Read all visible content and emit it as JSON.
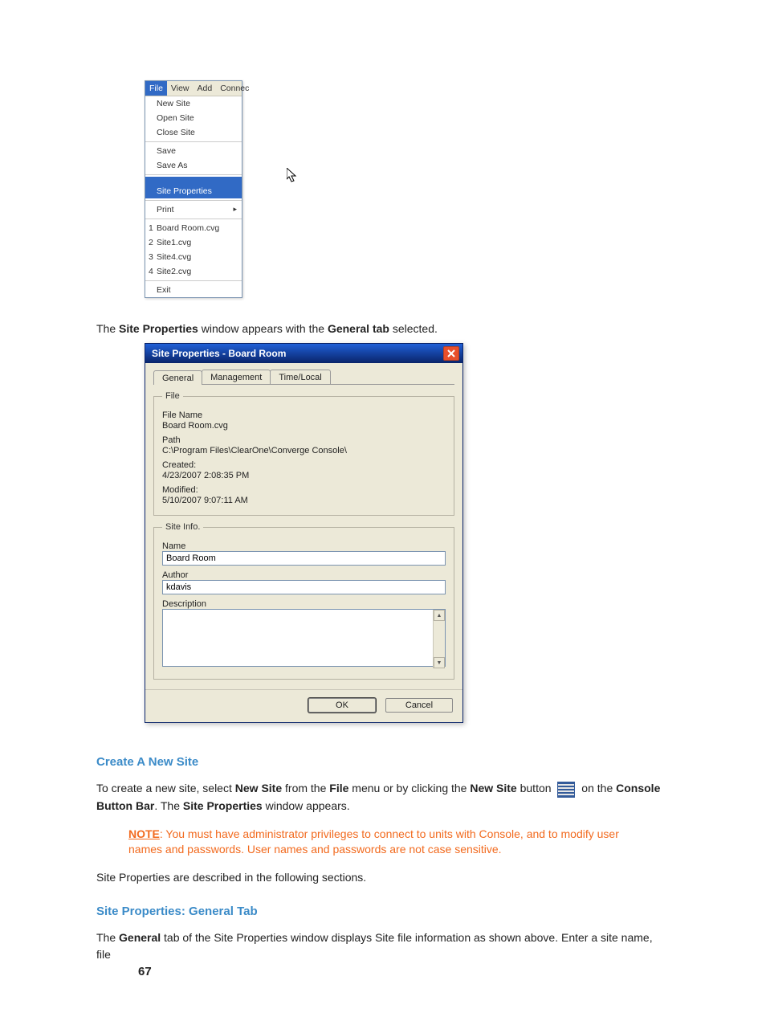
{
  "filemenu": {
    "menubar": [
      "File",
      "View",
      "Add",
      "Connec"
    ],
    "groups": [
      [
        "New Site",
        "Open Site",
        "Close Site"
      ],
      [
        "Save",
        "Save As"
      ],
      [
        "Site Properties"
      ],
      [
        "Print"
      ]
    ],
    "recent": [
      {
        "n": "1",
        "label": "Board Room.cvg"
      },
      {
        "n": "2",
        "label": "Site1.cvg"
      },
      {
        "n": "3",
        "label": "Site4.cvg"
      },
      {
        "n": "4",
        "label": "Site2.cvg"
      }
    ],
    "exit": "Exit"
  },
  "para1": {
    "a": "The ",
    "b": "Site Properties",
    "c": " window appears with the ",
    "d": "General tab",
    "e": " selected."
  },
  "dialog": {
    "title": "Site Properties - Board Room",
    "tabs": [
      "General",
      "Management",
      "Time/Local"
    ],
    "file_legend": "File",
    "filename_label": "File Name",
    "filename_value": "Board Room.cvg",
    "path_label": "Path",
    "path_value": "C:\\Program Files\\ClearOne\\Converge Console\\",
    "created_label": "Created:",
    "created_value": "4/23/2007 2:08:35 PM",
    "modified_label": "Modified:",
    "modified_value": "5/10/2007 9:07:11 AM",
    "siteinfo_legend": "Site Info.",
    "name_label": "Name",
    "name_value": "Board Room",
    "author_label": "Author",
    "author_value": "kdavis",
    "description_label": "Description",
    "ok": "OK",
    "cancel": "Cancel"
  },
  "sec1": "Create A New Site",
  "para2": {
    "a": "To create a new site, select ",
    "b": "New Site",
    "c": " from the ",
    "d": "File",
    "e": " menu or by clicking the ",
    "f": "New Site",
    "g": " button ",
    "h": " on the ",
    "i": "Console Button Bar",
    "j": ". The ",
    "k": "Site Properties",
    "l": " window appears."
  },
  "note": {
    "label": "NOTE",
    "text": ": You must have administrator privileges to connect to units with Console, and to modify user names and passwords. User names and passwords are not case sensitive."
  },
  "para3": "Site Properties are described in the following sections.",
  "sec2": "Site Properties: General Tab",
  "para4": {
    "a": "The ",
    "b": "General",
    "c": " tab of the Site Properties window displays Site file information as shown above. Enter a site name, file"
  },
  "pagenum": "67"
}
